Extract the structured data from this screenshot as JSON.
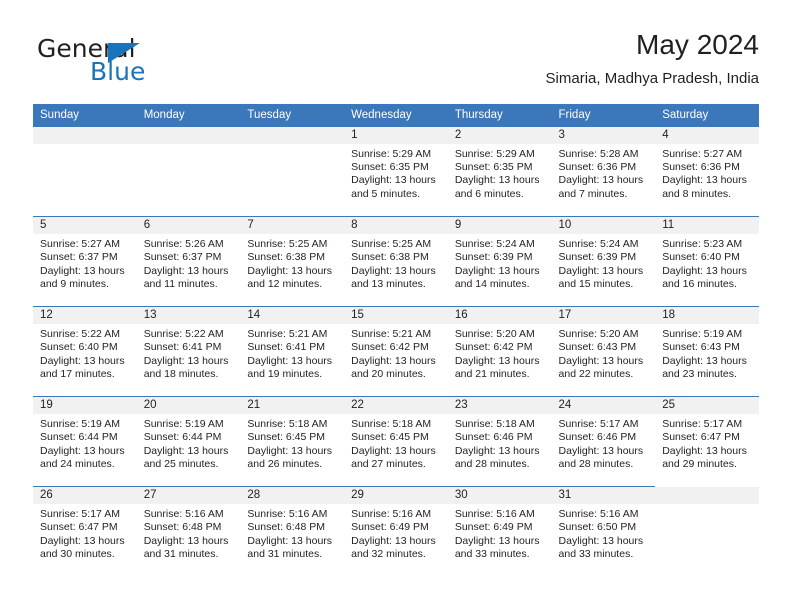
{
  "brand": {
    "name_top": "General",
    "name_bottom": "Blue",
    "accent_color": "#1a74bb"
  },
  "header": {
    "title": "May 2024",
    "subtitle": "Simaria, Madhya Pradesh, India"
  },
  "calendar": {
    "header_bg": "#3a77bb",
    "daynum_bg": "#f1f1f1",
    "weekday_headers": [
      "Sunday",
      "Monday",
      "Tuesday",
      "Wednesday",
      "Thursday",
      "Friday",
      "Saturday"
    ],
    "weeks": [
      [
        {
          "day": "",
          "sunrise": "",
          "sunset": "",
          "daylight": "",
          "daylight2": ""
        },
        {
          "day": "",
          "sunrise": "",
          "sunset": "",
          "daylight": "",
          "daylight2": ""
        },
        {
          "day": "",
          "sunrise": "",
          "sunset": "",
          "daylight": "",
          "daylight2": ""
        },
        {
          "day": "1",
          "sunrise": "Sunrise: 5:29 AM",
          "sunset": "Sunset: 6:35 PM",
          "daylight": "Daylight: 13 hours",
          "daylight2": "and 5 minutes."
        },
        {
          "day": "2",
          "sunrise": "Sunrise: 5:29 AM",
          "sunset": "Sunset: 6:35 PM",
          "daylight": "Daylight: 13 hours",
          "daylight2": "and 6 minutes."
        },
        {
          "day": "3",
          "sunrise": "Sunrise: 5:28 AM",
          "sunset": "Sunset: 6:36 PM",
          "daylight": "Daylight: 13 hours",
          "daylight2": "and 7 minutes."
        },
        {
          "day": "4",
          "sunrise": "Sunrise: 5:27 AM",
          "sunset": "Sunset: 6:36 PM",
          "daylight": "Daylight: 13 hours",
          "daylight2": "and 8 minutes."
        }
      ],
      [
        {
          "day": "5",
          "sunrise": "Sunrise: 5:27 AM",
          "sunset": "Sunset: 6:37 PM",
          "daylight": "Daylight: 13 hours",
          "daylight2": "and 9 minutes."
        },
        {
          "day": "6",
          "sunrise": "Sunrise: 5:26 AM",
          "sunset": "Sunset: 6:37 PM",
          "daylight": "Daylight: 13 hours",
          "daylight2": "and 11 minutes."
        },
        {
          "day": "7",
          "sunrise": "Sunrise: 5:25 AM",
          "sunset": "Sunset: 6:38 PM",
          "daylight": "Daylight: 13 hours",
          "daylight2": "and 12 minutes."
        },
        {
          "day": "8",
          "sunrise": "Sunrise: 5:25 AM",
          "sunset": "Sunset: 6:38 PM",
          "daylight": "Daylight: 13 hours",
          "daylight2": "and 13 minutes."
        },
        {
          "day": "9",
          "sunrise": "Sunrise: 5:24 AM",
          "sunset": "Sunset: 6:39 PM",
          "daylight": "Daylight: 13 hours",
          "daylight2": "and 14 minutes."
        },
        {
          "day": "10",
          "sunrise": "Sunrise: 5:24 AM",
          "sunset": "Sunset: 6:39 PM",
          "daylight": "Daylight: 13 hours",
          "daylight2": "and 15 minutes."
        },
        {
          "day": "11",
          "sunrise": "Sunrise: 5:23 AM",
          "sunset": "Sunset: 6:40 PM",
          "daylight": "Daylight: 13 hours",
          "daylight2": "and 16 minutes."
        }
      ],
      [
        {
          "day": "12",
          "sunrise": "Sunrise: 5:22 AM",
          "sunset": "Sunset: 6:40 PM",
          "daylight": "Daylight: 13 hours",
          "daylight2": "and 17 minutes."
        },
        {
          "day": "13",
          "sunrise": "Sunrise: 5:22 AM",
          "sunset": "Sunset: 6:41 PM",
          "daylight": "Daylight: 13 hours",
          "daylight2": "and 18 minutes."
        },
        {
          "day": "14",
          "sunrise": "Sunrise: 5:21 AM",
          "sunset": "Sunset: 6:41 PM",
          "daylight": "Daylight: 13 hours",
          "daylight2": "and 19 minutes."
        },
        {
          "day": "15",
          "sunrise": "Sunrise: 5:21 AM",
          "sunset": "Sunset: 6:42 PM",
          "daylight": "Daylight: 13 hours",
          "daylight2": "and 20 minutes."
        },
        {
          "day": "16",
          "sunrise": "Sunrise: 5:20 AM",
          "sunset": "Sunset: 6:42 PM",
          "daylight": "Daylight: 13 hours",
          "daylight2": "and 21 minutes."
        },
        {
          "day": "17",
          "sunrise": "Sunrise: 5:20 AM",
          "sunset": "Sunset: 6:43 PM",
          "daylight": "Daylight: 13 hours",
          "daylight2": "and 22 minutes."
        },
        {
          "day": "18",
          "sunrise": "Sunrise: 5:19 AM",
          "sunset": "Sunset: 6:43 PM",
          "daylight": "Daylight: 13 hours",
          "daylight2": "and 23 minutes."
        }
      ],
      [
        {
          "day": "19",
          "sunrise": "Sunrise: 5:19 AM",
          "sunset": "Sunset: 6:44 PM",
          "daylight": "Daylight: 13 hours",
          "daylight2": "and 24 minutes."
        },
        {
          "day": "20",
          "sunrise": "Sunrise: 5:19 AM",
          "sunset": "Sunset: 6:44 PM",
          "daylight": "Daylight: 13 hours",
          "daylight2": "and 25 minutes."
        },
        {
          "day": "21",
          "sunrise": "Sunrise: 5:18 AM",
          "sunset": "Sunset: 6:45 PM",
          "daylight": "Daylight: 13 hours",
          "daylight2": "and 26 minutes."
        },
        {
          "day": "22",
          "sunrise": "Sunrise: 5:18 AM",
          "sunset": "Sunset: 6:45 PM",
          "daylight": "Daylight: 13 hours",
          "daylight2": "and 27 minutes."
        },
        {
          "day": "23",
          "sunrise": "Sunrise: 5:18 AM",
          "sunset": "Sunset: 6:46 PM",
          "daylight": "Daylight: 13 hours",
          "daylight2": "and 28 minutes."
        },
        {
          "day": "24",
          "sunrise": "Sunrise: 5:17 AM",
          "sunset": "Sunset: 6:46 PM",
          "daylight": "Daylight: 13 hours",
          "daylight2": "and 28 minutes."
        },
        {
          "day": "25",
          "sunrise": "Sunrise: 5:17 AM",
          "sunset": "Sunset: 6:47 PM",
          "daylight": "Daylight: 13 hours",
          "daylight2": "and 29 minutes."
        }
      ],
      [
        {
          "day": "26",
          "sunrise": "Sunrise: 5:17 AM",
          "sunset": "Sunset: 6:47 PM",
          "daylight": "Daylight: 13 hours",
          "daylight2": "and 30 minutes."
        },
        {
          "day": "27",
          "sunrise": "Sunrise: 5:16 AM",
          "sunset": "Sunset: 6:48 PM",
          "daylight": "Daylight: 13 hours",
          "daylight2": "and 31 minutes."
        },
        {
          "day": "28",
          "sunrise": "Sunrise: 5:16 AM",
          "sunset": "Sunset: 6:48 PM",
          "daylight": "Daylight: 13 hours",
          "daylight2": "and 31 minutes."
        },
        {
          "day": "29",
          "sunrise": "Sunrise: 5:16 AM",
          "sunset": "Sunset: 6:49 PM",
          "daylight": "Daylight: 13 hours",
          "daylight2": "and 32 minutes."
        },
        {
          "day": "30",
          "sunrise": "Sunrise: 5:16 AM",
          "sunset": "Sunset: 6:49 PM",
          "daylight": "Daylight: 13 hours",
          "daylight2": "and 33 minutes."
        },
        {
          "day": "31",
          "sunrise": "Sunrise: 5:16 AM",
          "sunset": "Sunset: 6:50 PM",
          "daylight": "Daylight: 13 hours",
          "daylight2": "and 33 minutes."
        },
        {
          "day": "",
          "sunrise": "",
          "sunset": "",
          "daylight": "",
          "daylight2": ""
        }
      ]
    ]
  }
}
